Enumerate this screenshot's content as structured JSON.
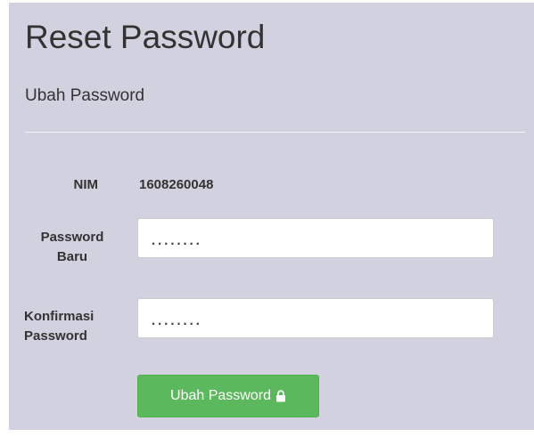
{
  "page": {
    "title": "Reset Password",
    "subtitle": "Ubah Password"
  },
  "form": {
    "nim": {
      "label": "NIM",
      "value": "1608260048"
    },
    "new_password": {
      "label_line1": "Password",
      "label_line2": "Baru",
      "value": "........"
    },
    "confirm_password": {
      "label_line1": "Konfirmasi",
      "label_line2": "Password",
      "value": "........"
    },
    "submit": {
      "label": "Ubah Password",
      "icon": "lock-icon"
    }
  },
  "colors": {
    "panel_background": "#d2d1df",
    "button_green": "#5cb85c",
    "text": "#333333"
  }
}
